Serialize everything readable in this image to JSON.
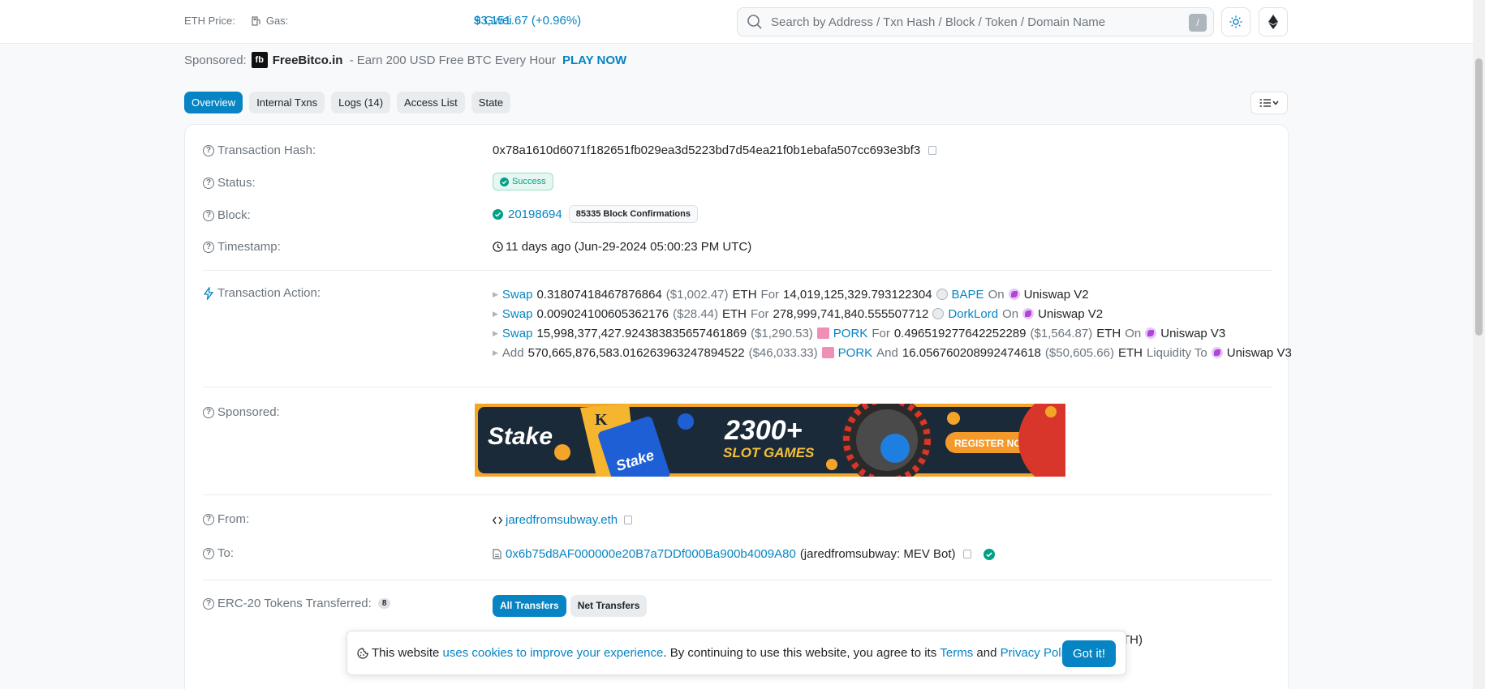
{
  "topbar": {
    "eth_price_label": "ETH Price:",
    "eth_price_value": "$3,151.67 (+0.96%)",
    "gas_label": "Gas:",
    "gas_value": "9 Gwei",
    "search_placeholder": "Search by Address / Txn Hash / Block / Token / Domain Name",
    "search_shortcut": "/"
  },
  "sponsor_top": {
    "label": "Sponsored:",
    "logo_text": "fb",
    "brand": "FreeBitco.in",
    "text": " - Earn 200 USD Free BTC Every Hour ",
    "cta": "PLAY NOW"
  },
  "tabs": [
    "Overview",
    "Internal Txns",
    "Logs (14)",
    "Access List",
    "State"
  ],
  "tx": {
    "hash_label": "Transaction Hash:",
    "hash": "0x78a1610d6071f182651fb029ea3d5223bd7d54ea21f0b1ebafa507cc693e3bf3",
    "status_label": "Status:",
    "status": "Success",
    "block_label": "Block:",
    "block": "20198694",
    "confirmations": "85335 Block Confirmations",
    "timestamp_label": "Timestamp:",
    "timestamp": "11 days ago (Jun-29-2024 05:00:23 PM UTC)",
    "action_label": "Transaction Action:",
    "actions": [
      {
        "verb": "Swap",
        "amount": "0.31807418467876864",
        "usd": "($1,002.47)",
        "token": "ETH",
        "for": "For",
        "amount2": "14,019,125,329.793122304",
        "token2": "BAPE",
        "on": "On",
        "dex": "Uniswap V2"
      },
      {
        "verb": "Swap",
        "amount": "0.009024100605362176",
        "usd": "($28.44)",
        "token": "ETH",
        "for": "For",
        "amount2": "278,999,741,840.555507712",
        "token2": "DorkLord",
        "on": "On",
        "dex": "Uniswap V2"
      },
      {
        "verb": "Swap",
        "amount": "15,998,377,427.924383835657461869",
        "usd": "($1,290.53)",
        "token": "PORK",
        "for": "For",
        "amount2": "0.496519277642252289",
        "usd2": "($1,564.87)",
        "token2": "ETH",
        "on": "On",
        "dex": "Uniswap V3"
      },
      {
        "verb": "Add",
        "amount": "570,665,876,583.016263963247894522",
        "usd": "($46,033.33)",
        "token": "PORK",
        "and": "And",
        "amount2": "16.056760208992474618",
        "usd2": "($50,605.66)",
        "token2": "ETH",
        "liq": "Liquidity To",
        "dex": "Uniswap V3"
      }
    ],
    "sponsored_label": "Sponsored:",
    "banner": {
      "brand": "Stake",
      "headline": "2300+",
      "sub": "SLOT GAMES",
      "cta": "REGISTER NOW",
      "card_text": "Stake",
      "card_letter": "K"
    },
    "from_label": "From:",
    "from": "jaredfromsubway.eth",
    "to_label": "To:",
    "to_address": "0x6b75d8AF000000e20B7a7DDf000Ba900b4009A80",
    "to_name": "(jaredfromsubway: MEV Bot)",
    "erc20_label": "ERC-20 Tokens Transferred:",
    "erc20_count": "8",
    "transfer_tabs": [
      "All Transfers",
      "Net Transfers"
    ],
    "hidden_tail": "TH)"
  },
  "cookie": {
    "prefix": "This website ",
    "link1": "uses cookies to improve your experience",
    "middle": ". By continuing to use this website, you agree to its ",
    "link2": "Terms",
    "and": " and ",
    "link3": "Privacy Policy",
    "end": ".",
    "button": "Got it!"
  },
  "colors": {
    "accent": "#0784c3",
    "success": "#00a186"
  }
}
